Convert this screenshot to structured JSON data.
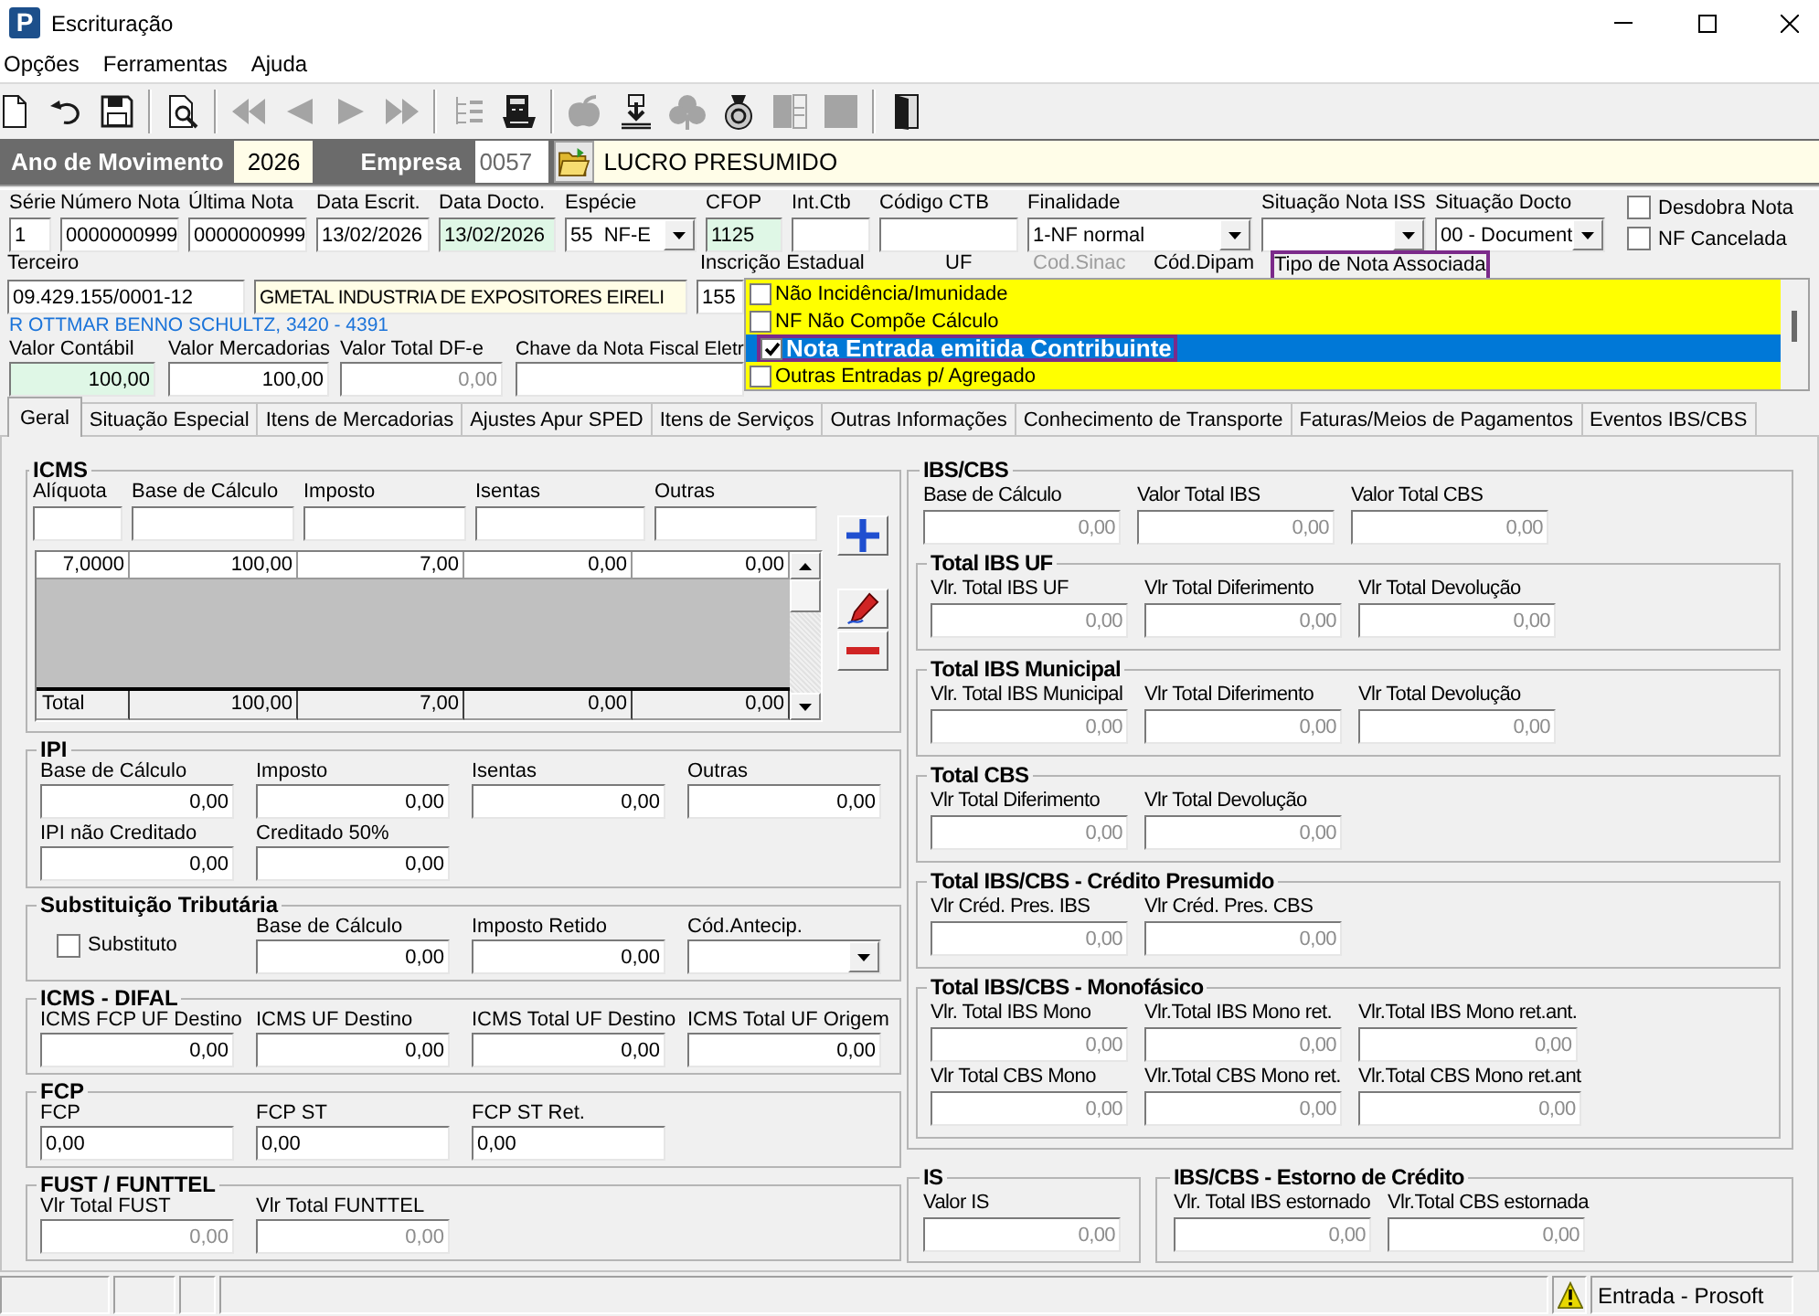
{
  "window": {
    "icon_letter": "P",
    "title": "Escrituração"
  },
  "menu": [
    "Opções",
    "Ferramentas",
    "Ajuda"
  ],
  "toolbar": [
    {
      "kind": "new",
      "disabled": false
    },
    {
      "kind": "undo",
      "disabled": false
    },
    {
      "kind": "save",
      "disabled": false
    },
    {
      "kind": "separator"
    },
    {
      "kind": "preview",
      "disabled": false
    },
    {
      "kind": "separator"
    },
    {
      "kind": "first",
      "disabled": true
    },
    {
      "kind": "prev",
      "disabled": true
    },
    {
      "kind": "next",
      "disabled": true
    },
    {
      "kind": "last",
      "disabled": true
    },
    {
      "kind": "separator"
    },
    {
      "kind": "tree",
      "disabled": true
    },
    {
      "kind": "calc",
      "disabled": false
    },
    {
      "kind": "separator"
    },
    {
      "kind": "apple",
      "disabled": true
    },
    {
      "kind": "import",
      "disabled": false
    },
    {
      "kind": "club",
      "disabled": true
    },
    {
      "kind": "bag",
      "disabled": false
    },
    {
      "kind": "panel",
      "disabled": true
    },
    {
      "kind": "square",
      "disabled": true
    },
    {
      "kind": "separator"
    },
    {
      "kind": "exit",
      "disabled": false
    }
  ],
  "header": {
    "year_label": "Ano de Movimento",
    "year": "2026",
    "company_label": "Empresa",
    "company_code": "0057",
    "company_name": "LUCRO PRESUMIDO"
  },
  "document_fields": [
    {
      "label": "Série",
      "value": "1",
      "kind": "text"
    },
    {
      "label": "Número Nota",
      "value": "0000000999",
      "kind": "text"
    },
    {
      "label": "Última Nota",
      "value": "0000000999",
      "kind": "text"
    },
    {
      "label": "Data Escrit.",
      "value": "13/02/2026",
      "kind": "text"
    },
    {
      "label": "Data Docto.",
      "value": "13/02/2026",
      "kind": "text",
      "color": "#dff7e6"
    },
    {
      "label": "Espécie",
      "value": "55  NF-E",
      "kind": "select"
    },
    {
      "label": "CFOP",
      "value": "1125",
      "kind": "text",
      "color": "#dff7e6"
    },
    {
      "label": "Int.Ctb",
      "kind": "text"
    },
    {
      "label": "Código CTB",
      "kind": "text"
    },
    {
      "label": "Finalidade",
      "value": "1-NF normal",
      "kind": "select"
    },
    {
      "label": "Situação Nota ISS",
      "kind": "select"
    },
    {
      "label": "Situação Docto",
      "value": "00 - Document",
      "kind": "select"
    }
  ],
  "document_flags": [
    {
      "label": "Desdobra Nota",
      "checked": false
    },
    {
      "label": "NF Cancelada",
      "checked": false
    }
  ],
  "party": {
    "labels": [
      {
        "text": "Terceiro",
        "disabled": false,
        "highlighted": false
      },
      {
        "text": "Inscrição Estadual",
        "disabled": false,
        "highlighted": false
      },
      {
        "text": "UF",
        "disabled": false,
        "highlighted": false
      },
      {
        "text": "Cod.Sinac",
        "disabled": true,
        "highlighted": false
      },
      {
        "text": "Cód.Dipam",
        "disabled": false,
        "highlighted": false
      },
      {
        "text": "Tipo de Nota Associada",
        "disabled": false,
        "highlighted": true
      }
    ],
    "fields": [
      {
        "value": "09.429.155/0001-12"
      },
      {
        "value": "GMETAL INDUSTRIA DE EXPOSITORES EIRELI",
        "color": "#fffde6"
      },
      {
        "value": "155"
      }
    ],
    "address": "R OTTMAR BENNO SCHULTZ, 3420 - 4391"
  },
  "values": [
    {
      "label": "Valor Contábil",
      "value": "100,00",
      "kind": "number",
      "disabled": false,
      "color": "#dff7e6"
    },
    {
      "label": "Valor Mercadorias",
      "value": "100,00",
      "kind": "number",
      "disabled": false
    },
    {
      "label": "Valor Total DF-e",
      "value": "0,00",
      "kind": "number",
      "disabled": true
    },
    {
      "label": "Chave da Nota Fiscal Eletr",
      "kind": "text",
      "disabled": false
    }
  ],
  "note_type_list": {
    "items": [
      {
        "label": "Não Incidência/Imunidade",
        "checked": false,
        "selected": false,
        "highlighted": false
      },
      {
        "label": "NF Não Compõe Cálculo",
        "checked": false,
        "selected": false,
        "highlighted": false
      },
      {
        "label": "Nota Entrada emitida Contribuinte",
        "checked": true,
        "selected": true,
        "highlighted": true
      },
      {
        "label": "Outras Entradas p/ Agregado",
        "checked": false,
        "selected": false,
        "highlighted": false
      }
    ]
  },
  "tabs": [
    {
      "label": "Geral",
      "selected": true
    },
    {
      "label": "Situação Especial",
      "selected": false
    },
    {
      "label": "Itens de Mercadorias",
      "selected": false
    },
    {
      "label": "Ajustes Apur SPED",
      "selected": false
    },
    {
      "label": "Itens de Serviços",
      "selected": false
    },
    {
      "label": "Outras Informações",
      "selected": false
    },
    {
      "label": "Conhecimento de Transporte",
      "selected": false
    },
    {
      "label": "Faturas/Meios de Pagamentos",
      "selected": false
    },
    {
      "label": "Eventos IBS/CBS",
      "selected": false
    }
  ],
  "icms": {
    "title": "ICMS",
    "columns": [
      "Alíquota",
      "Base de Cálculo",
      "Imposto",
      "Isentas",
      "Outras"
    ],
    "rows": [
      [
        "7,0000",
        "100,00",
        "7,00",
        "0,00",
        "0,00"
      ]
    ],
    "total": [
      "Total",
      "100,00",
      "7,00",
      "0,00",
      "0,00"
    ],
    "actions": [
      {
        "kind": "add"
      },
      {
        "kind": "edit"
      },
      {
        "kind": "remove"
      }
    ]
  },
  "left_groups": [
    {
      "title": "IPI",
      "rows": [
        [
          {
            "label": "Base de Cálculo",
            "value": "0,00",
            "kind": "number",
            "disabled": false
          },
          {
            "label": "Imposto",
            "value": "0,00",
            "kind": "number",
            "disabled": false
          },
          {
            "label": "Isentas",
            "value": "0,00",
            "kind": "number",
            "disabled": false
          },
          {
            "label": "Outras",
            "value": "0,00",
            "kind": "number",
            "disabled": false
          }
        ],
        [
          {
            "label": "IPI não Creditado",
            "value": "0,00",
            "kind": "number",
            "disabled": false
          },
          {
            "label": "Creditado 50%",
            "value": "0,00",
            "kind": "number",
            "disabled": false
          }
        ]
      ]
    },
    {
      "title": "Substituição Tributária",
      "rows": [
        [
          {
            "label": "Substituto",
            "kind": "checkbox",
            "checked": false
          },
          {
            "label": "Base de Cálculo",
            "value": "0,00",
            "kind": "number",
            "disabled": false
          },
          {
            "label": "Imposto Retido",
            "value": "0,00",
            "kind": "number",
            "disabled": false
          },
          {
            "label": "Cód.Antecip.",
            "kind": "select"
          }
        ]
      ]
    },
    {
      "title": "ICMS - DIFAL",
      "rows": [
        [
          {
            "label": "ICMS FCP UF Destino",
            "value": "0,00",
            "kind": "number",
            "disabled": false
          },
          {
            "label": "ICMS UF Destino",
            "value": "0,00",
            "kind": "number",
            "disabled": false
          },
          {
            "label": "ICMS Total UF Destino",
            "value": "0,00",
            "kind": "number",
            "disabled": false
          },
          {
            "label": "ICMS Total UF Origem",
            "value": "0,00",
            "kind": "number",
            "disabled": false
          }
        ]
      ]
    },
    {
      "title": "FCP",
      "rows": [
        [
          {
            "label": "FCP",
            "value": "0,00",
            "kind": "text",
            "disabled": false
          },
          {
            "label": "FCP ST",
            "value": "0,00",
            "kind": "text",
            "disabled": false
          },
          {
            "label": "FCP ST Ret.",
            "value": "0,00",
            "kind": "text",
            "disabled": false
          }
        ]
      ]
    },
    {
      "title": "FUST / FUNTTEL",
      "rows": [
        [
          {
            "label": "Vlr Total FUST",
            "value": "0,00",
            "kind": "number",
            "disabled": true
          },
          {
            "label": "Vlr Total FUNTTEL",
            "value": "0,00",
            "kind": "number",
            "disabled": true
          }
        ]
      ]
    }
  ],
  "ibs_cbs": {
    "title": "IBS/CBS",
    "rows": [
      [
        {
          "label": "Base de Cálculo",
          "value": "0,00",
          "kind": "number",
          "disabled": true
        },
        {
          "label": "Valor Total IBS",
          "value": "0,00",
          "kind": "number",
          "disabled": true
        },
        {
          "label": "Valor Total CBS",
          "value": "0,00",
          "kind": "number",
          "disabled": true
        }
      ]
    ],
    "groups": [
      {
        "title": "Total IBS UF",
        "rows": [
          [
            {
              "label": "Vlr. Total IBS UF",
              "value": "0,00",
              "kind": "number",
              "disabled": true
            },
            {
              "label": "Vlr Total Diferimento",
              "value": "0,00",
              "kind": "number",
              "disabled": true
            },
            {
              "label": "Vlr Total Devolução",
              "value": "0,00",
              "kind": "number",
              "disabled": true
            }
          ]
        ]
      },
      {
        "title": "Total IBS Municipal",
        "rows": [
          [
            {
              "label": "Vlr. Total IBS Municipal",
              "value": "0,00",
              "kind": "number",
              "disabled": true
            },
            {
              "label": "Vlr Total Diferimento",
              "value": "0,00",
              "kind": "number",
              "disabled": true
            },
            {
              "label": "Vlr Total Devolução",
              "value": "0,00",
              "kind": "number",
              "disabled": true
            }
          ]
        ]
      },
      {
        "title": "Total CBS",
        "rows": [
          [
            {
              "label": "Vlr Total Diferimento",
              "value": "0,00",
              "kind": "number",
              "disabled": true
            },
            {
              "label": "Vlr Total Devolução",
              "value": "0,00",
              "kind": "number",
              "disabled": true
            }
          ]
        ]
      },
      {
        "title": "Total IBS/CBS - Crédito Presumido",
        "rows": [
          [
            {
              "label": "Vlr Créd. Pres. IBS",
              "value": "0,00",
              "kind": "number",
              "disabled": true
            },
            {
              "label": "Vlr Créd. Pres. CBS",
              "value": "0,00",
              "kind": "number",
              "disabled": true
            }
          ]
        ]
      },
      {
        "title": "Total IBS/CBS - Monofásico",
        "rows": [
          [
            {
              "label": "Vlr. Total IBS Mono",
              "value": "0,00",
              "kind": "number",
              "disabled": true
            },
            {
              "label": "Vlr.Total IBS Mono ret.",
              "value": "0,00",
              "kind": "number",
              "disabled": true
            },
            {
              "label": "Vlr.Total IBS Mono ret.ant.",
              "value": "0,00",
              "kind": "number",
              "disabled": true
            }
          ],
          [
            {
              "label": "Vlr Total CBS Mono",
              "value": "0,00",
              "kind": "number",
              "disabled": true
            },
            {
              "label": "Vlr.Total CBS Mono ret.",
              "value": "0,00",
              "kind": "number",
              "disabled": true
            },
            {
              "label": "Vlr.Total CBS Mono ret.ant",
              "value": "0,00",
              "kind": "number",
              "disabled": true
            }
          ]
        ]
      }
    ]
  },
  "bottom_right": [
    {
      "title": "IS",
      "rows": [
        [
          {
            "label": "Valor IS",
            "value": "0,00",
            "kind": "number",
            "disabled": true
          }
        ]
      ]
    },
    {
      "title": "IBS/CBS - Estorno de Crédito",
      "rows": [
        [
          {
            "label": "Vlr. Total IBS estornado",
            "value": "0,00",
            "kind": "number",
            "disabled": true
          },
          {
            "label": "Vlr.Total CBS estornada",
            "value": "0,00",
            "kind": "number",
            "disabled": true
          }
        ]
      ]
    }
  ],
  "status_bar": {
    "text": "Entrada - Prosoft"
  }
}
